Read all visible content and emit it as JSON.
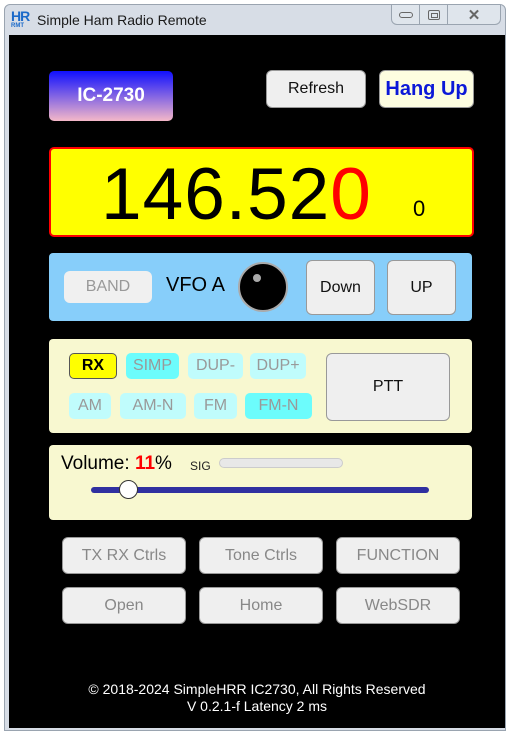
{
  "window": {
    "title": "Simple Ham Radio Remote",
    "logo_top": "HR",
    "logo_bottom": "RMT",
    "close_glyph": "✕"
  },
  "header": {
    "model_label": "IC-2730",
    "refresh_label": "Refresh",
    "hangup_label": "Hang Up"
  },
  "frequency": {
    "main_black": "146.52",
    "main_red": "0",
    "sub_digit": "0"
  },
  "vfo": {
    "band_label": "BAND",
    "vfo_label": "VFO A",
    "down_label": "Down",
    "up_label": "UP"
  },
  "modes": {
    "rx_label": "RX",
    "duplex": [
      {
        "label": "SIMP",
        "active": true
      },
      {
        "label": "DUP-",
        "active": false
      },
      {
        "label": "DUP+",
        "active": false
      }
    ],
    "modulation": [
      {
        "label": "AM",
        "active": false
      },
      {
        "label": "AM-N",
        "active": false
      },
      {
        "label": "FM",
        "active": false
      },
      {
        "label": "FM-N",
        "active": true
      }
    ],
    "ptt_label": "PTT"
  },
  "volume": {
    "label": "Volume:",
    "value": "11",
    "unit": "%",
    "percent": 11,
    "sig_label": "SIG",
    "sig_level_percent": 0
  },
  "nav": {
    "row1": [
      "TX RX Ctrls",
      "Tone Ctrls",
      "FUNCTION"
    ],
    "row2": [
      "Open",
      "Home",
      "WebSDR"
    ]
  },
  "footer": {
    "copyright": "© 2018-2024 SimpleHRR IC2730,  All Rights Reserved",
    "version_line": "V 0.2.1-f  Latency   2    ms"
  }
}
